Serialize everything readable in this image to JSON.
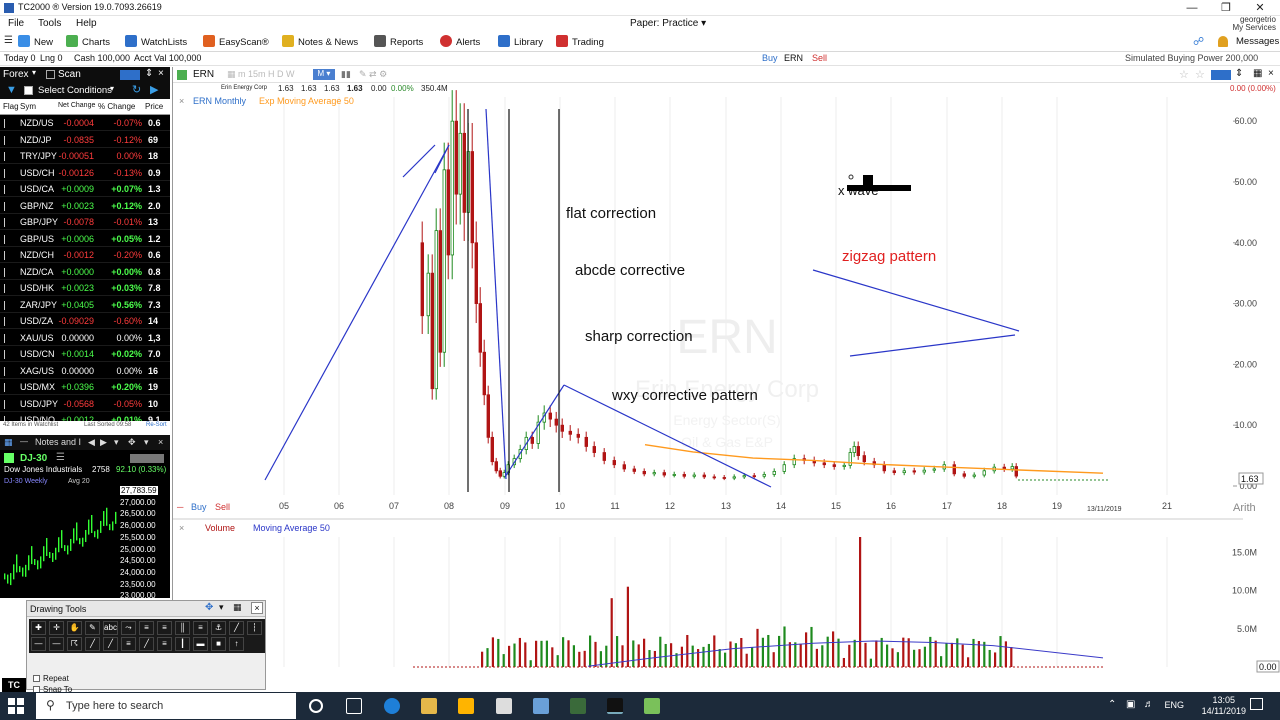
{
  "window": {
    "title": "TC2000 ® Version 19.0.7093.26619",
    "controls": [
      "—",
      "❐",
      "✕"
    ]
  },
  "menu": {
    "items": [
      "File",
      "Tools",
      "Help"
    ],
    "account_mode": "Paper: Practice ▾",
    "user": "georgetrio",
    "user_sub": "My Services"
  },
  "toolbar": {
    "items": [
      {
        "label": "New",
        "icon": "new-layout-icon",
        "color": "#3a8ee6"
      },
      {
        "label": "Charts",
        "icon": "charts-icon",
        "color": "#4caf50"
      },
      {
        "label": "WatchLists",
        "icon": "watchlists-icon",
        "color": "#2e6fc9"
      },
      {
        "label": "EasyScan®",
        "icon": "easyscan-icon",
        "color": "#e06020"
      },
      {
        "label": "Notes & News",
        "icon": "notes-icon",
        "color": "#e0b020"
      },
      {
        "label": "Reports",
        "icon": "reports-icon",
        "color": "#555555"
      },
      {
        "label": "Alerts",
        "icon": "alerts-icon",
        "color": "#d03030"
      },
      {
        "label": "Library",
        "icon": "library-icon",
        "color": "#2e6fc9"
      },
      {
        "label": "Trading",
        "icon": "trading-icon",
        "color": "#d03030"
      }
    ],
    "messages": "Messages"
  },
  "account_bar": {
    "today": "Today 0",
    "lng": "Lng 0",
    "cash": "Cash 100,000",
    "acct_val": "Acct Val 100,000",
    "buy": "Buy",
    "symbol": "ERN",
    "sell": "Sell",
    "buying_power": "Simulated Buying Power 200,000"
  },
  "watchlist": {
    "title": "Forex",
    "scan": "Scan",
    "conditions": "Select Conditions",
    "columns": [
      "Flag",
      "Sym",
      "Net Change",
      "% Change",
      "Price"
    ],
    "rows": [
      {
        "sym": "NZD/US",
        "nc": "-0.0004",
        "pc": "-0.07%",
        "pr": "0.6",
        "up": false
      },
      {
        "sym": "NZD/JP",
        "nc": "-0.0835",
        "pc": "-0.12%",
        "pr": "69",
        "up": false
      },
      {
        "sym": "TRY/JPY",
        "nc": "-0.00051",
        "pc": "0.00%",
        "pr": "18",
        "up": false
      },
      {
        "sym": "USD/CH",
        "nc": "-0.00126",
        "pc": "-0.13%",
        "pr": "0.9",
        "up": false
      },
      {
        "sym": "USD/CA",
        "nc": "+0.0009",
        "pc": "+0.07%",
        "pr": "1.3",
        "up": true
      },
      {
        "sym": "GBP/NZ",
        "nc": "+0.0023",
        "pc": "+0.12%",
        "pr": "2.0",
        "up": true
      },
      {
        "sym": "GBP/JPY",
        "nc": "-0.0078",
        "pc": "-0.01%",
        "pr": "13",
        "up": false
      },
      {
        "sym": "GBP/US",
        "nc": "+0.0006",
        "pc": "+0.05%",
        "pr": "1.2",
        "up": true
      },
      {
        "sym": "NZD/CH",
        "nc": "-0.0012",
        "pc": "-0.20%",
        "pr": "0.6",
        "up": false
      },
      {
        "sym": "NZD/CA",
        "nc": "+0.0000",
        "pc": "+0.00%",
        "pr": "0.8",
        "up": true
      },
      {
        "sym": "USD/HK",
        "nc": "+0.0023",
        "pc": "+0.03%",
        "pr": "7.8",
        "up": true
      },
      {
        "sym": "ZAR/JPY",
        "nc": "+0.0405",
        "pc": "+0.56%",
        "pr": "7.3",
        "up": true
      },
      {
        "sym": "USD/ZA",
        "nc": "-0.09029",
        "pc": "-0.60%",
        "pr": "14",
        "up": false
      },
      {
        "sym": "XAU/US",
        "nc": "0.00000",
        "pc": "0.00%",
        "pr": "1,3",
        "up": null
      },
      {
        "sym": "USD/CN",
        "nc": "+0.0014",
        "pc": "+0.02%",
        "pr": "7.0",
        "up": true
      },
      {
        "sym": "XAG/US",
        "nc": "0.00000",
        "pc": "0.00%",
        "pr": "16",
        "up": null
      },
      {
        "sym": "USD/MX",
        "nc": "+0.0396",
        "pc": "+0.20%",
        "pr": "19",
        "up": true
      },
      {
        "sym": "USD/JPY",
        "nc": "-0.0568",
        "pc": "-0.05%",
        "pr": "10",
        "up": false
      },
      {
        "sym": "USD/NO",
        "nc": "+0.0012",
        "pc": "+0.01%",
        "pr": "9.1",
        "up": true
      }
    ],
    "status_left": "42 Items in Watchlist",
    "status_mid": "Last Sorted 09:58",
    "status_right": "Re-Sort"
  },
  "mini_chart": {
    "tab": "Notes and I",
    "symbol": "DJ-30",
    "name": "Dow Jones Industrials",
    "quote": "2758",
    "change": "92.10 (0.33%)",
    "label": "DJ-30 Weekly",
    "avg": "Avg 20",
    "axis": [
      "27,783.59",
      "27,000.00",
      "26,500.00",
      "26,000.00",
      "25,500.00",
      "25,000.00",
      "24,500.00",
      "24,000.00",
      "23,500.00",
      "23,000.00"
    ]
  },
  "drawing_tools": {
    "title": "Drawing Tools",
    "repeat": "Repeat",
    "snap": "Snap To"
  },
  "chart": {
    "symbol": "ERN",
    "company": "Erin Energy Corp",
    "o": "1.63",
    "h": "1.63",
    "l": "1.63",
    "c": "1.63",
    "chg": "0.00",
    "pct": "0.00%",
    "vol": "350.4M",
    "indicator_main": "ERN Monthly",
    "indicator_ema": "Exp Moving Average 50",
    "indicator_vol": "Volume",
    "indicator_vol_ma": "Moving Average 50",
    "buy": "Buy",
    "sell": "Sell",
    "change_readout": "0.00 (0.00%)",
    "scale_mode": "Arith",
    "last_price": "1.63",
    "vol_last": "0.00",
    "watermark_symbol": "ERN",
    "watermark_name": "Erin Energy Corp",
    "watermark_sector": "Energy Sector(S)",
    "watermark_industry": "Oil & Gas E&P",
    "date_label": "13/11/2019",
    "annotations": {
      "flat": "flat correction",
      "abcde": "abcde corrective",
      "sharp": "sharp correction",
      "wxy": "wxy corrective pattern",
      "zigzag": "zigzag pattern",
      "xwave": "x wave"
    },
    "colors": {
      "up": "#1e8a1e",
      "down": "#b01414",
      "ema": "#ff9a1e",
      "trend": "#2a36c8",
      "zigzag": "#e02020"
    }
  },
  "chart_data": {
    "type": "candlestick",
    "x_tick_labels": [
      "05",
      "06",
      "07",
      "08",
      "09",
      "10",
      "11",
      "12",
      "13",
      "14",
      "15",
      "16",
      "17",
      "18",
      "19",
      "21"
    ],
    "y_tick_labels": [
      "60.00",
      "50.00",
      "40.00",
      "30.00",
      "20.00",
      "10.00",
      "0.00"
    ],
    "ylim": [
      0,
      62
    ],
    "volume_tick_labels": [
      "15.0M",
      "10.0M",
      "5.0M",
      "0.00"
    ],
    "volume_ylim": [
      0,
      17
    ]
  },
  "taskbar": {
    "search": "Type here to search",
    "lang": "ENG",
    "time": "13:05",
    "date": "14/11/2019"
  }
}
